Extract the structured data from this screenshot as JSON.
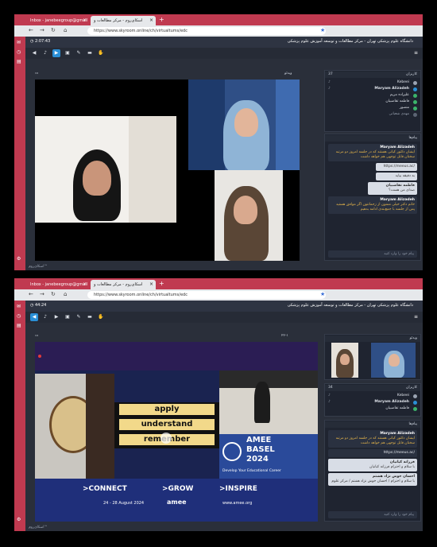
{
  "screenshots": [
    {
      "tabs": {
        "inactive": "Inbox - janebeegroup@gmail",
        "active": "اسکای‌روم - مرکز مطالعات و",
        "close": "×",
        "new": "+"
      },
      "url": "https://www.skyroom.online/ch/virtualtums/edc",
      "timer": "2:07:43",
      "institution": "دانشگاه علوم پزشکی تهران - مرکز مطالعات و توسعه آموزش علوم پزشکی",
      "stage_label": "ویدئو",
      "users_label": "کاربران",
      "users_count": "37",
      "users": [
        "Kebeei",
        "Maryam Alizadeh",
        "علیزاده مریم",
        "فاطمه تقاضبیان",
        "منصور",
        "مهدی شعبانی"
      ],
      "chat_label": "پیام‌ها",
      "messages": [
        {
          "who": "Maryam Alizadeh",
          "body": "ایشان دکتور کیانی هستند که در جلسه امروز دو مرتبه سخنان قابل توجهی هم خواهد داشت",
          "style": "dark"
        },
        {
          "who": "",
          "body": "https://meeus.ac/",
          "style": "card"
        },
        {
          "who": "",
          "body": "به دقیقه بیاید",
          "style": "dark"
        },
        {
          "who": "فاطمه تقاضبیان",
          "body": "صدای من هست؟",
          "style": "dark"
        },
        {
          "who": "Maryam Alizadeh",
          "body": "خانم دکتر خیلی ممنون از زحماتتون اگر موافق هستید پس از جلسه با جمع‌بندی ادامه بدهیم",
          "style": "dark"
        }
      ],
      "chat_placeholder": "پیام خود را وارد کنید",
      "footer": "اسکای‌روم™"
    },
    {
      "tabs": {
        "inactive": "Inbox - janebeegroup@gmail",
        "active": "اسکای‌روم - مرکز مطالعات و",
        "close": "×",
        "new": "+"
      },
      "url": "https://www.skyroom.online/ch/virtualtums/edc",
      "timer": "44:24",
      "institution": "دانشگاه علوم پزشکی تهران - مرکز مطالعات و توسعه آموزش علوم پزشکی",
      "stage_label": "۲۲-۱",
      "video_label": "ویدئو",
      "users_label": "کاربران",
      "users_count": "34",
      "users": [
        "Kebeei",
        "Maryam Alizadeh",
        "فاطمه تقاضبیان"
      ],
      "chat_label": "پیام‌ها",
      "messages": [
        {
          "who": "Maryam Alizadeh",
          "body": "ایشان دکتور کیانی هستند که در جلسه امروز دو مرتبه سخنان قابل توجهی هم خواهد داشت",
          "style": "dark"
        },
        {
          "who": "",
          "body": "https://meeus.ac/",
          "style": "dark"
        },
        {
          "who": "فرزانه کیانیان",
          "body": "با سلام و احترام فرزانه کیانیان",
          "style": "card"
        },
        {
          "who": "احسان خوش نژاد هشتم",
          "body": "با سلام و احترام / احسان خوش نژاد هشتم / مرکز علوم",
          "style": "card"
        }
      ],
      "chat_placeholder": "پیام خود را وارد کنید",
      "slide": {
        "words": [
          "apply",
          "understand",
          "remember"
        ],
        "event_name": "AMEE",
        "event_place": "BASEL",
        "event_year": "2024",
        "tagline": "Develop Your Educational Career",
        "ctas": [
          ">CONNECT",
          ">GROW",
          ">INSPIRE"
        ],
        "dates": "24 - 28 August 2024",
        "brand": "amee",
        "site": "www.amee.org"
      },
      "footer": "اسکای‌روم™"
    }
  ],
  "colors": {
    "browser_accent": "#c03a50",
    "app_bg": "#2a2f3a",
    "active_tool": "#2a8fd6",
    "chat_highlight": "#e8b74a"
  }
}
